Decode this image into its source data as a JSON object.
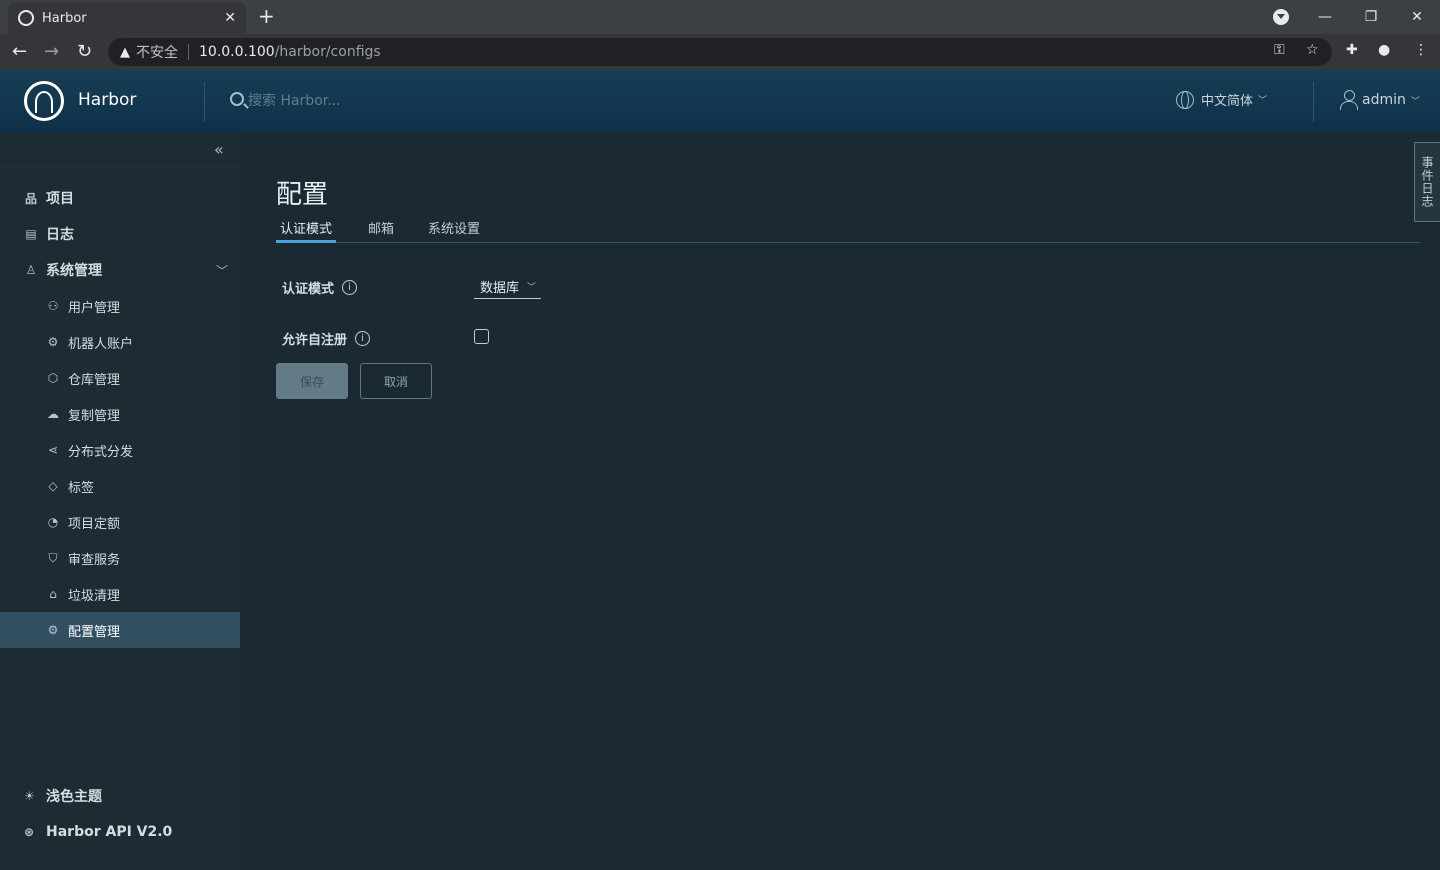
{
  "browser": {
    "tab_title": "Harbor",
    "insecure_label": "不安全",
    "url_host": "10.0.0.100",
    "url_path": "/harbor/configs"
  },
  "header": {
    "brand": "Harbor",
    "search_placeholder": "搜索 Harbor...",
    "language": "中文简体",
    "user": "admin"
  },
  "sidebar": {
    "items": [
      {
        "label": "项目",
        "icon": "project-icon"
      },
      {
        "label": "日志",
        "icon": "log-icon"
      },
      {
        "label": "系统管理",
        "icon": "admin-icon"
      }
    ],
    "sub_items": [
      {
        "label": "用户管理",
        "icon": "users-icon"
      },
      {
        "label": "机器人账户",
        "icon": "robot-icon"
      },
      {
        "label": "仓库管理",
        "icon": "registry-icon"
      },
      {
        "label": "复制管理",
        "icon": "replication-icon"
      },
      {
        "label": "分布式分发",
        "icon": "share-icon"
      },
      {
        "label": "标签",
        "icon": "tag-icon"
      },
      {
        "label": "项目定额",
        "icon": "quota-icon"
      },
      {
        "label": "审查服务",
        "icon": "shield-icon"
      },
      {
        "label": "垃圾清理",
        "icon": "trash-icon"
      },
      {
        "label": "配置管理",
        "icon": "gear-icon"
      }
    ],
    "bottom": [
      {
        "label": "浅色主题",
        "icon": "sun-icon"
      },
      {
        "label": "Harbor API V2.0",
        "icon": "api-icon"
      }
    ]
  },
  "main": {
    "title": "配置",
    "tabs": [
      "认证模式",
      "邮箱",
      "系统设置"
    ],
    "auth_mode_label": "认证模式",
    "auth_mode_value": "数据库",
    "self_reg_label": "允许自注册",
    "save_label": "保存",
    "cancel_label": "取消",
    "event_log_label": "事件日志"
  }
}
